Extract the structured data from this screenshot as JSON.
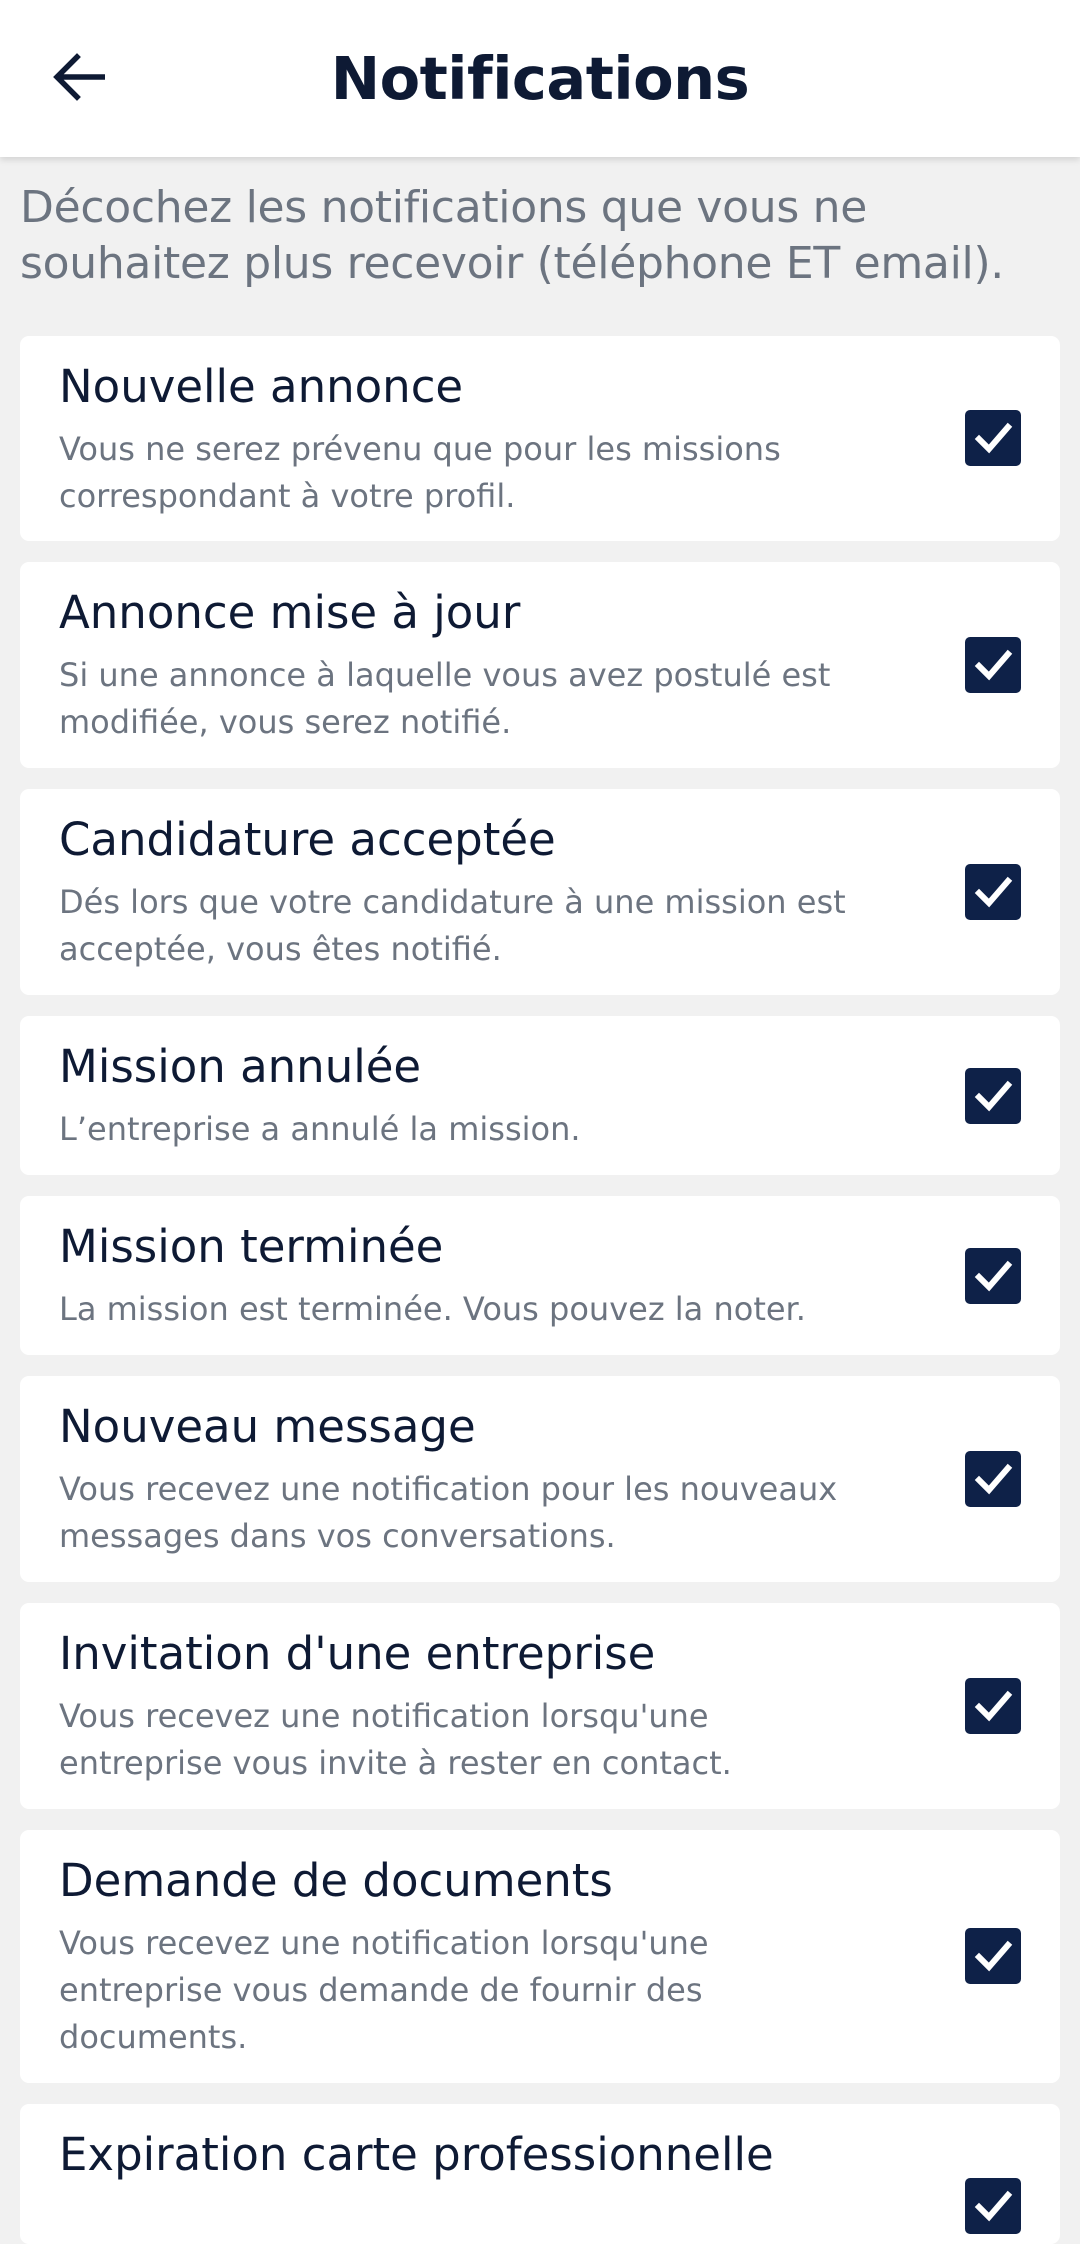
{
  "header": {
    "title": "Notifications",
    "back_icon": "arrow-left-icon"
  },
  "intro": "Décochez les notifications que vous ne souhaitez plus recevoir (téléphone ET email).",
  "colors": {
    "title_text": "#0e1a34",
    "secondary_text": "#6c7480",
    "checkbox_fill": "#0e2148",
    "background": "#f1f1f1",
    "card_background": "#ffffff"
  },
  "notifications": [
    {
      "title": "Nouvelle annonce",
      "description": "Vous ne serez prévenu que pour les missions correspondant à votre profil.",
      "checked": true
    },
    {
      "title": "Annonce mise à jour",
      "description": "Si une annonce à laquelle vous avez postulé est modifiée, vous serez notifié.",
      "checked": true
    },
    {
      "title": "Candidature acceptée",
      "description": "Dés lors que votre candidature à une mission est acceptée, vous êtes notifié.",
      "checked": true
    },
    {
      "title": "Mission annulée",
      "description": "L’entreprise a annulé la mission.",
      "checked": true
    },
    {
      "title": "Mission terminée",
      "description": "La mission est terminée. Vous pouvez la noter.",
      "checked": true
    },
    {
      "title": "Nouveau message",
      "description": "Vous recevez une notification pour les nouveaux messages dans vos conversations.",
      "checked": true
    },
    {
      "title": "Invitation d'une entreprise",
      "description": "Vous recevez une notification lorsqu'une entreprise vous invite à rester en contact.",
      "checked": true
    },
    {
      "title": "Demande de documents",
      "description": "Vous recevez une notification lorsqu'une entreprise vous demande de fournir des documents.",
      "checked": true
    },
    {
      "title": "Expiration carte professionnelle",
      "description": "",
      "checked": true
    }
  ]
}
